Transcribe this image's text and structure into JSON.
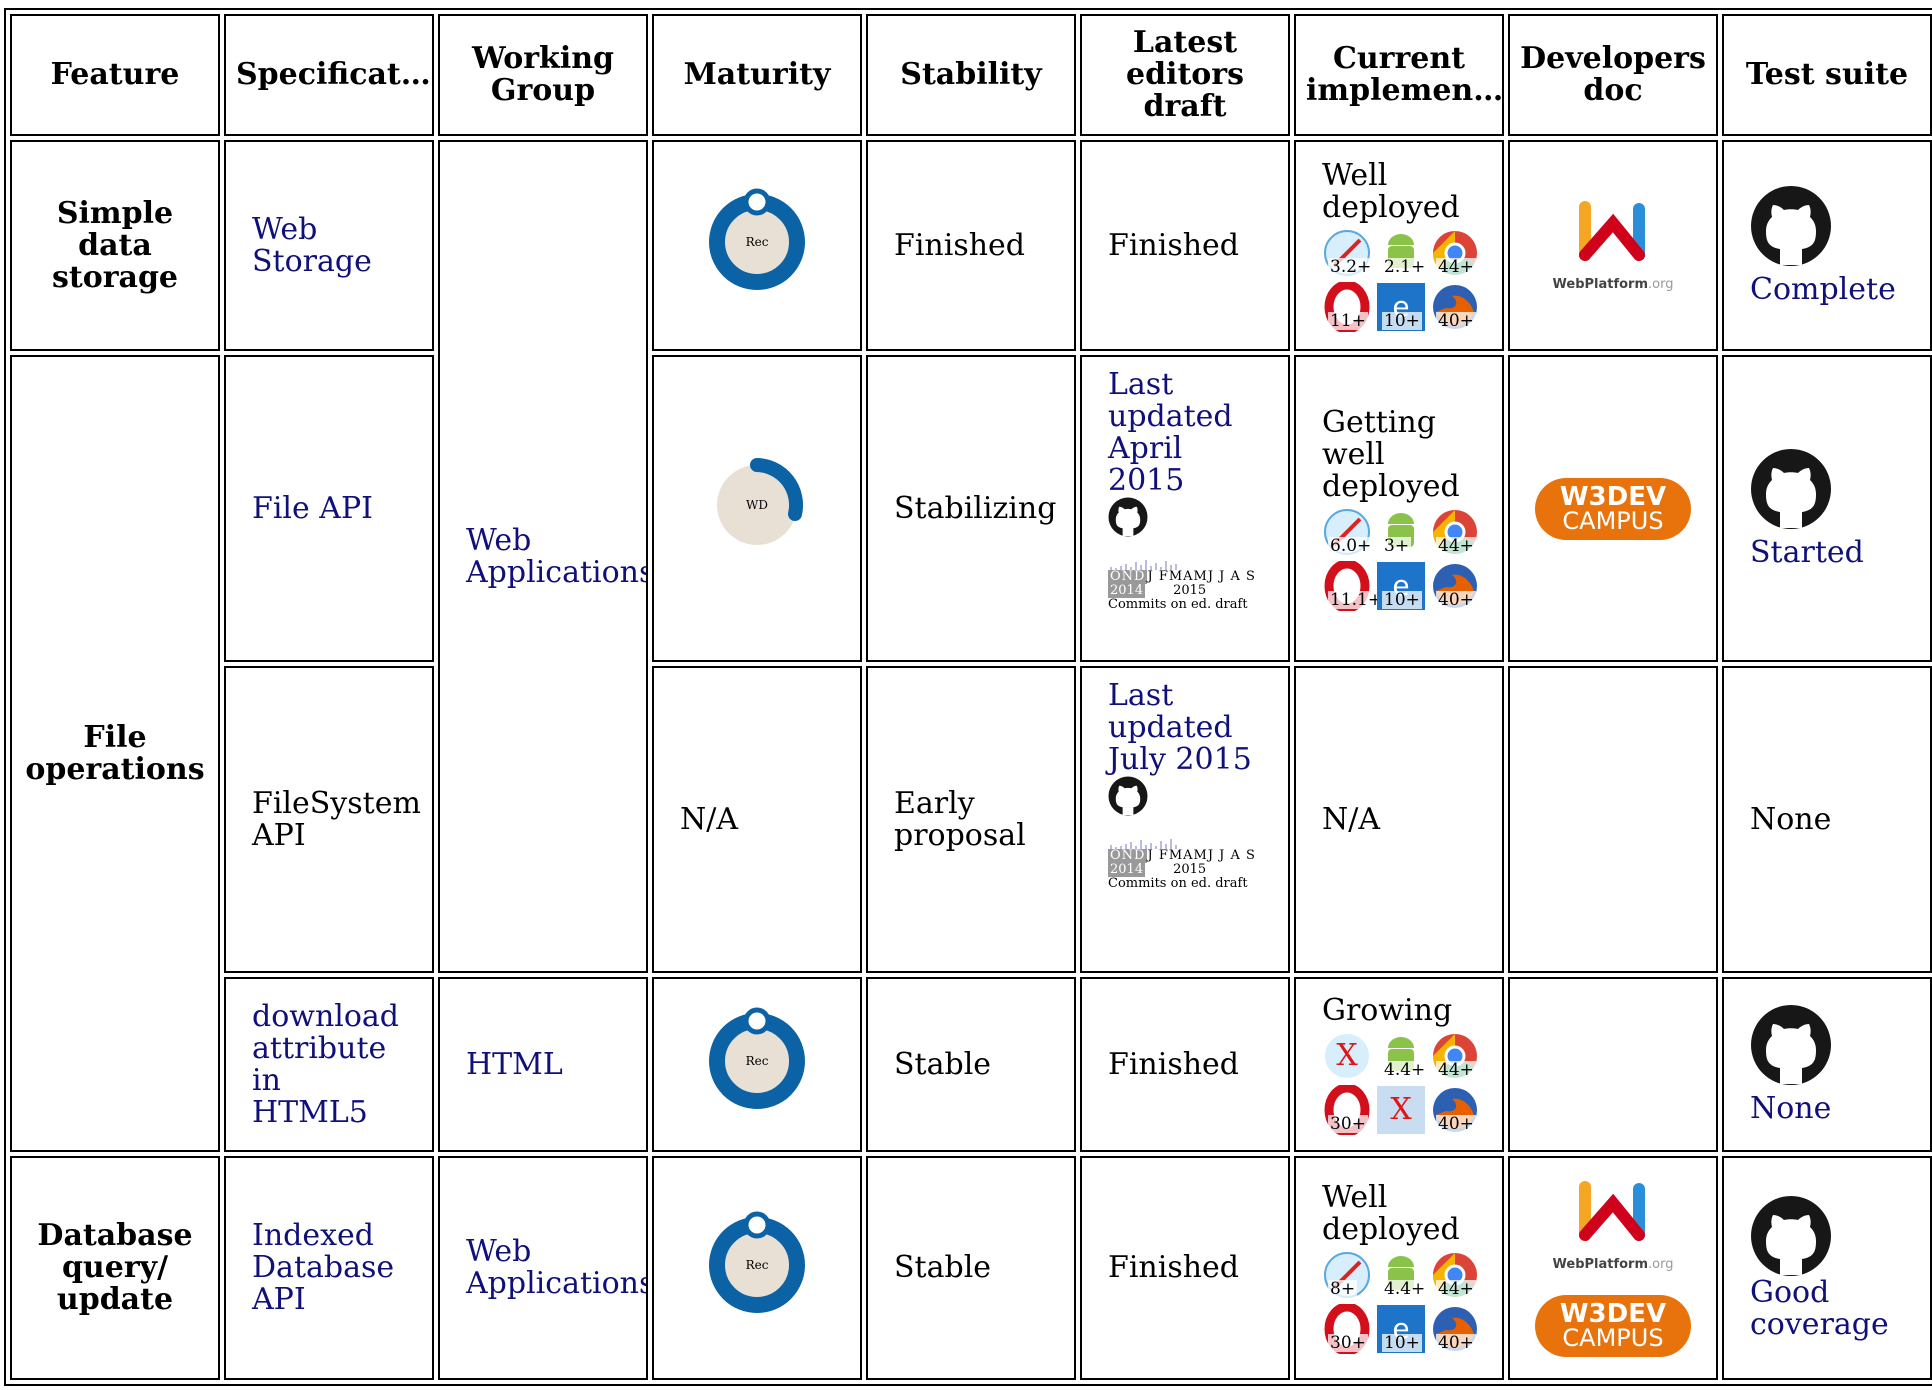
{
  "headers": [
    "Feature",
    "Specificat…",
    "Working Group",
    "Maturity",
    "Stability",
    "Latest editors draft",
    "Current implemen…",
    "Developers doc",
    "Test suite"
  ],
  "rows": [
    {
      "feature": "Simple data storage",
      "spec": "Web Storage",
      "wg": "Web Applications",
      "maturity": "Rec",
      "stability": "Finished",
      "draft": "Finished",
      "impl_status": "Well deployed",
      "browsers": [
        "3.2+",
        "2.1+",
        "44+",
        "11+",
        "10+",
        "40+"
      ],
      "devdoc": "WebPlatform.org",
      "tests": "Complete"
    },
    {
      "feature": "File operations",
      "spec": "File API",
      "maturity": "WD",
      "stability": "Stabilizing",
      "draft": "Last updated April 2015",
      "impl_status": "Getting well deployed",
      "browsers": [
        "6.0+",
        "3+",
        "44+",
        "11.1+",
        "10+",
        "40+"
      ],
      "devdoc": "W3DEV CAMPUS",
      "tests": "Started"
    },
    {
      "spec": "FileSystem API",
      "maturity": "N/A",
      "stability": "Early proposal",
      "draft": "Last updated July 2015",
      "impl_status": "N/A",
      "tests": "None"
    },
    {
      "spec": "download attribute in HTML5",
      "wg": "HTML",
      "maturity": "Rec",
      "stability": "Stable",
      "draft": "Finished",
      "impl_status": "Growing",
      "browsers": [
        "X",
        "4.4+",
        "44+",
        "30+",
        "X",
        "40+"
      ],
      "tests": "None"
    },
    {
      "feature": "Database query/ update",
      "spec": "Indexed Database API",
      "wg": "Web Applications",
      "maturity": "Rec",
      "stability": "Stable",
      "draft": "Finished",
      "impl_status": "Well deployed",
      "browsers": [
        "8+",
        "4.4+",
        "44+",
        "30+",
        "10+",
        "40+"
      ],
      "devdoc": "WebPlatform.org",
      "devdoc2": "W3DEV CAMPUS",
      "tests": "Good coverage"
    }
  ],
  "commits": {
    "months_2014": "OND",
    "months_2015": "J FMAMJ J A S",
    "year1": "2014",
    "year2": "2015",
    "caption": "Commits on ed. draft"
  },
  "brand": {
    "wp_word": "WebPlatform",
    "wp_suffix": ".org",
    "w3dev_top": "W3DEV",
    "w3dev_bottom": "CAMPUS"
  },
  "colors": {
    "maturity_ring": "#0b62a4",
    "maturity_fill": "#e8e0d4",
    "link": "#10107a",
    "w3dev": "#e8730c"
  }
}
